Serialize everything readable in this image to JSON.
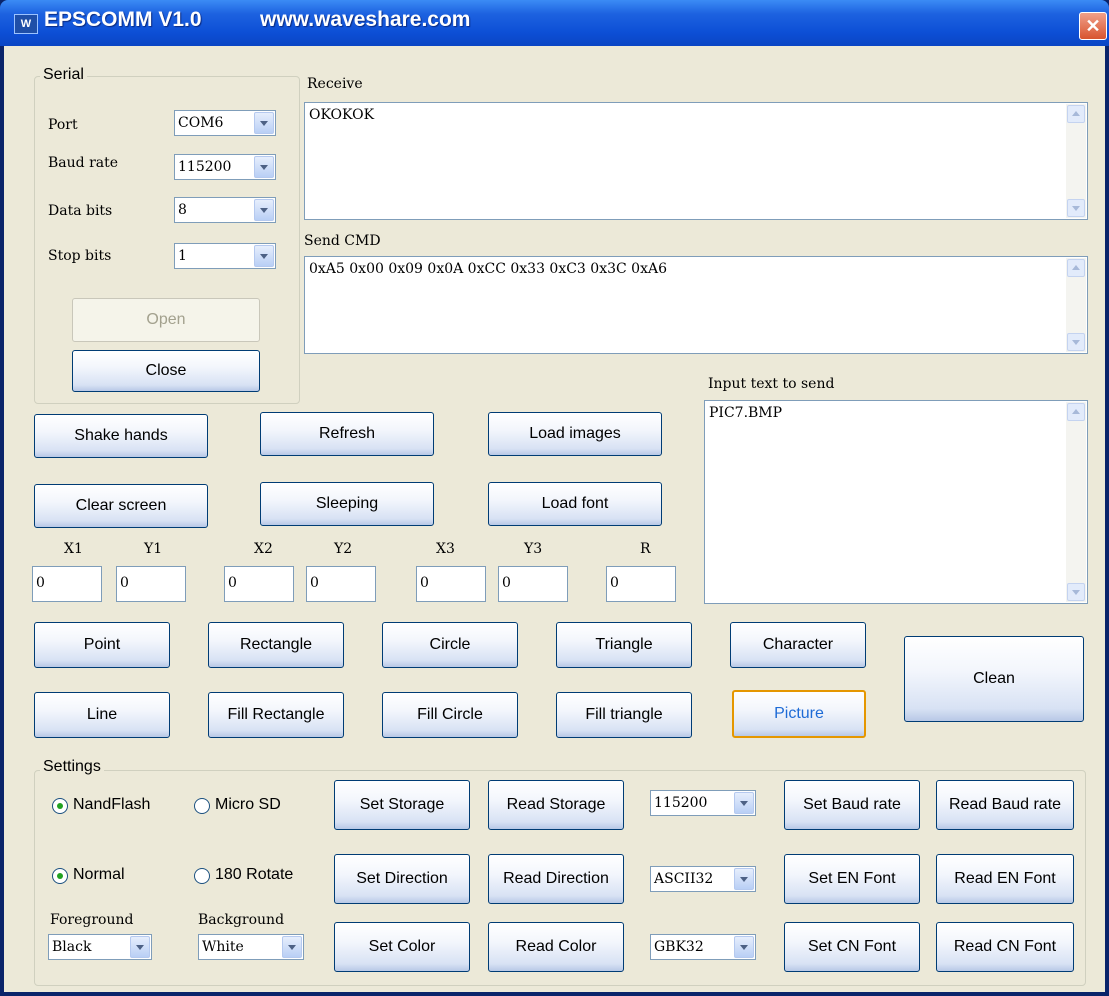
{
  "window": {
    "title": "EPSCOMM V1.0",
    "url": "www.waveshare.com",
    "icon": "waveshare-icon",
    "close": "✕",
    "close_icon": "close-icon"
  },
  "serial": {
    "title": "Serial",
    "port_label": "Port",
    "port_value": "COM6",
    "baud_label": "Baud rate",
    "baud_value": "115200",
    "databits_label": "Data bits",
    "databits_value": "8",
    "stopbits_label": "Stop bits",
    "stopbits_value": "1",
    "open": "Open",
    "close": "Close"
  },
  "receive": {
    "label": "Receive",
    "text": "OKOKOK"
  },
  "send_cmd": {
    "label": "Send CMD",
    "text": "0xA5 0x00 0x09 0x0A 0xCC 0x33 0xC3 0x3C 0xA6"
  },
  "input_text": {
    "label": "Input text to send",
    "text": "PIC7.BMP"
  },
  "commands": {
    "shake_hands": "Shake hands",
    "refresh": "Refresh",
    "load_images": "Load images",
    "clear_screen": "Clear screen",
    "sleeping": "Sleeping",
    "load_font": "Load font"
  },
  "coords": {
    "x1": {
      "label": "X1",
      "value": "0"
    },
    "y1": {
      "label": "Y1",
      "value": "0"
    },
    "x2": {
      "label": "X2",
      "value": "0"
    },
    "y2": {
      "label": "Y2",
      "value": "0"
    },
    "x3": {
      "label": "X3",
      "value": "0"
    },
    "y3": {
      "label": "Y3",
      "value": "0"
    },
    "r": {
      "label": "R",
      "value": "0"
    }
  },
  "draw": {
    "point": "Point",
    "rectangle": "Rectangle",
    "circle": "Circle",
    "triangle": "Triangle",
    "character": "Character",
    "line": "Line",
    "fill_rectangle": "Fill Rectangle",
    "fill_circle": "Fill Circle",
    "fill_triangle": "Fill triangle",
    "picture": "Picture",
    "clean": "Clean"
  },
  "settings": {
    "title": "Settings",
    "nandflash": "NandFlash",
    "microsd": "Micro SD",
    "normal": "Normal",
    "rotate": "180 Rotate",
    "foreground_label": "Foreground",
    "foreground_value": "Black",
    "background_label": "Background",
    "background_value": "White",
    "set_storage": "Set Storage",
    "read_storage": "Read Storage",
    "set_direction": "Set Direction",
    "read_direction": "Read Direction",
    "set_color": "Set Color",
    "read_color": "Read Color",
    "baud_value": "115200",
    "en_font_value": "ASCII32",
    "cn_font_value": "GBK32",
    "set_baud": "Set Baud rate",
    "read_baud": "Read Baud rate",
    "set_en_font": "Set EN Font",
    "read_en_font": "Read EN Font",
    "set_cn_font": "Set CN Font",
    "read_cn_font": "Read CN Font"
  },
  "colors": {
    "title_bar": "#0d4fd6",
    "face": "#ece9d8",
    "button_border": "#003c74",
    "focus": "#e59700",
    "radio_dot": "#21a121"
  }
}
